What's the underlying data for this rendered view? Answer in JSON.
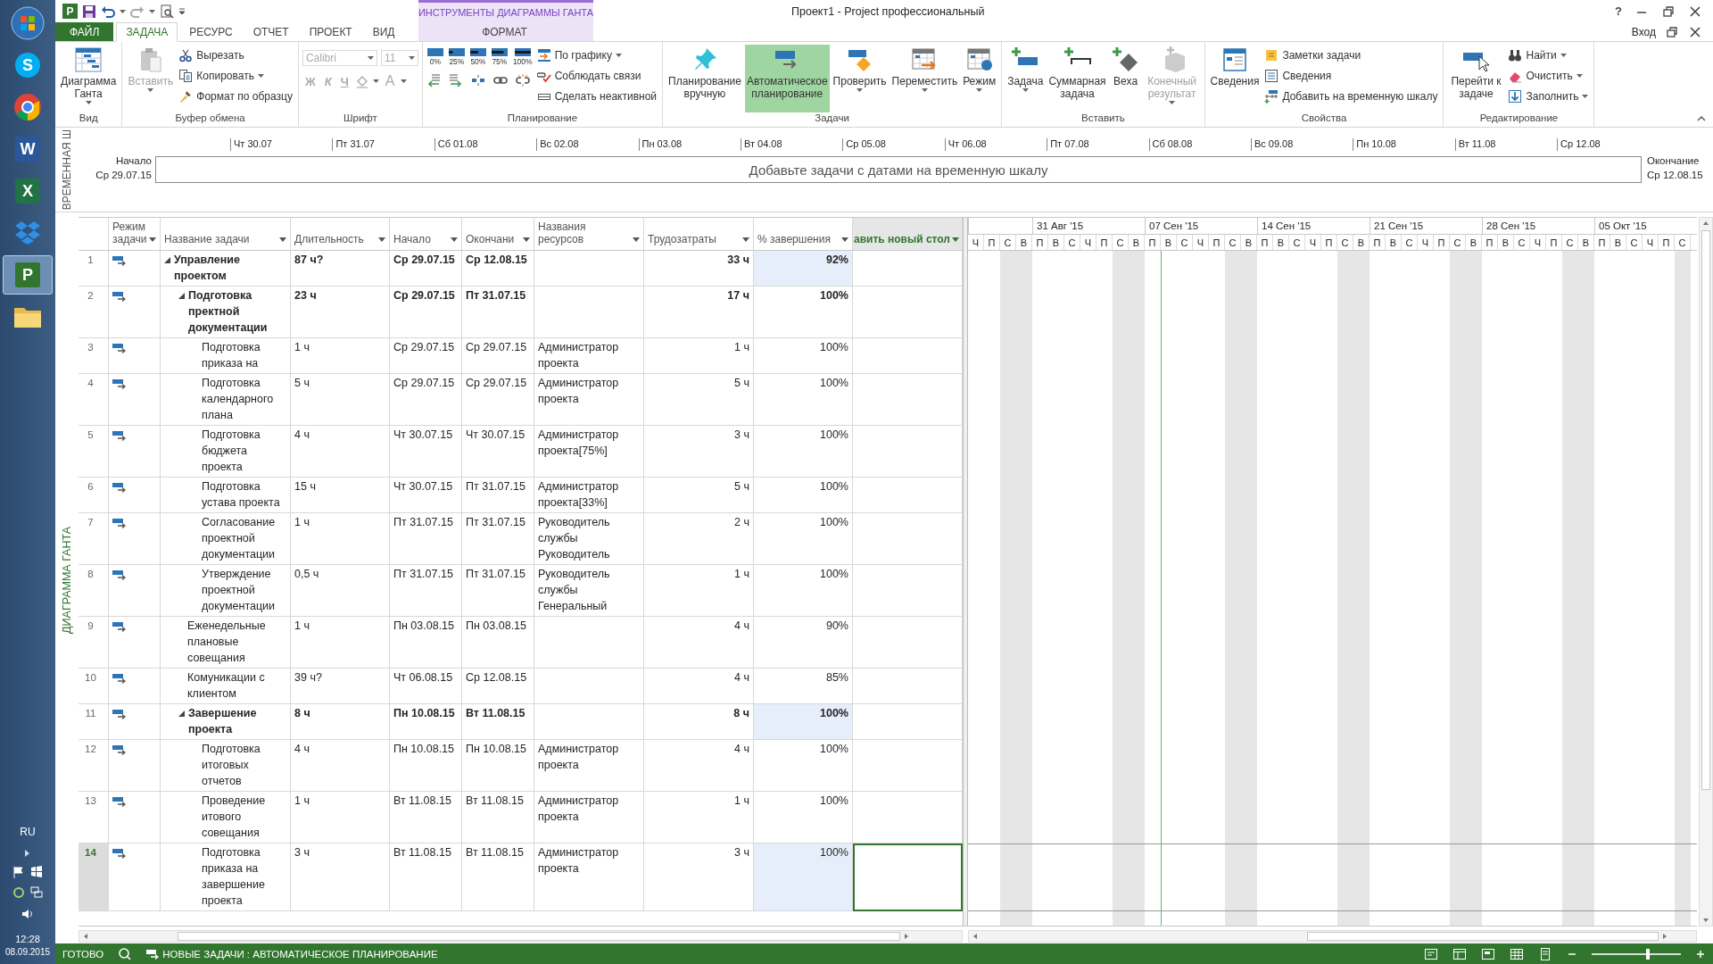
{
  "taskbar": {
    "apps": [
      {
        "kind": "start",
        "selected": false
      },
      {
        "kind": "chat",
        "glyph": "S",
        "selected": false
      },
      {
        "kind": "browser",
        "selected": false
      },
      {
        "kind": "word",
        "glyph": "W",
        "selected": false
      },
      {
        "kind": "sheet",
        "glyph": "X",
        "selected": false
      },
      {
        "kind": "box",
        "selected": false
      },
      {
        "kind": "project",
        "glyph": "P",
        "selected": true
      },
      {
        "kind": "folder",
        "selected": false
      }
    ],
    "language": "RU",
    "time": "12:28",
    "date": "08.09.2015"
  },
  "title_bar": {
    "app_glyph": "P",
    "title": "Проект1 - Project профессиональный",
    "help": "?",
    "context_group": "ИНСТРУМЕНТЫ ДИАГРАММЫ ГАНТА",
    "account": "Вход"
  },
  "tabs": [
    {
      "label": "ФАЙЛ",
      "kind": "file",
      "selected": false
    },
    {
      "label": "ЗАДАЧА",
      "kind": "tab",
      "selected": true
    },
    {
      "label": "РЕСУРС",
      "kind": "tab",
      "selected": false
    },
    {
      "label": "ОТЧЕТ",
      "kind": "tab",
      "selected": false
    },
    {
      "label": "ПРОЕКТ",
      "kind": "tab",
      "selected": false
    },
    {
      "label": "ВИД",
      "kind": "tab",
      "selected": false
    },
    {
      "label": "ФОРМАТ",
      "kind": "contextual",
      "selected": false
    }
  ],
  "ribbon": {
    "groups": [
      {
        "label": "Вид",
        "items": [
          {
            "kind": "large",
            "label": "Диаграмма Ганта",
            "dropdown": true,
            "disabled": false
          }
        ]
      },
      {
        "label": "Буфер обмена",
        "items": [
          {
            "kind": "large",
            "label": "Вставить",
            "dropdown": true,
            "disabled": true
          },
          {
            "kind": "stack",
            "items": [
              {
                "label": "Вырезать",
                "dropdown": false
              },
              {
                "label": "Копировать",
                "dropdown": true
              },
              {
                "label": "Формат по образцу",
                "dropdown": false
              }
            ]
          }
        ]
      },
      {
        "label": "Шрифт",
        "items": [
          {
            "kind": "font",
            "font": "Calibri",
            "size": "11",
            "styles": [
              "Ж",
              "К",
              "Ч"
            ],
            "color_letter": "A",
            "disabled": true
          }
        ]
      },
      {
        "label": "Планирование",
        "items": [
          {
            "kind": "percent",
            "labels": [
              "0%",
              "25%",
              "50%",
              "75%",
              "100%"
            ]
          },
          {
            "kind": "stack",
            "items": [
              {
                "label": "По графику",
                "dropdown": true
              },
              {
                "label": "Соблюдать связи",
                "dropdown": false
              },
              {
                "label": "Сделать неактивной",
                "dropdown": false
              }
            ]
          }
        ]
      },
      {
        "label": "Задачи",
        "items": [
          {
            "kind": "large",
            "label": "Планирование вручную",
            "dropdown": false,
            "disabled": false,
            "selected": false
          },
          {
            "kind": "large",
            "label": "Автоматическое планирование",
            "dropdown": false,
            "disabled": false,
            "selected": true
          },
          {
            "kind": "large",
            "label": "Проверить",
            "dropdown": true,
            "disabled": false
          },
          {
            "kind": "large",
            "label": "Переместить",
            "dropdown": true,
            "disabled": false
          },
          {
            "kind": "large",
            "label": "Режим",
            "dropdown": true,
            "disabled": false
          }
        ]
      },
      {
        "label": "Вставить",
        "items": [
          {
            "kind": "large",
            "label": "Задача",
            "dropdown": true,
            "disabled": false
          },
          {
            "kind": "large",
            "label": "Суммарная задача",
            "dropdown": false,
            "disabled": false
          },
          {
            "kind": "large",
            "label": "Веха",
            "dropdown": false,
            "disabled": false
          },
          {
            "kind": "large",
            "label": "Конечный результат",
            "dropdown": true,
            "disabled": true
          }
        ]
      },
      {
        "label": "Свойства",
        "items": [
          {
            "kind": "large",
            "label": "Сведения",
            "dropdown": false,
            "disabled": false
          },
          {
            "kind": "stack",
            "items": [
              {
                "label": "Заметки задачи",
                "dropdown": false
              },
              {
                "label": "Сведения",
                "dropdown": false
              },
              {
                "label": "Добавить на временную шкалу",
                "dropdown": false
              }
            ]
          }
        ]
      },
      {
        "label": "Редактирование",
        "items": [
          {
            "kind": "large",
            "label": "Перейти к задаче",
            "dropdown": false,
            "disabled": false
          },
          {
            "kind": "stack",
            "items": [
              {
                "label": "Найти",
                "dropdown": true
              },
              {
                "label": "Очистить",
                "dropdown": true
              },
              {
                "label": "Заполнить",
                "dropdown": true
              }
            ]
          }
        ]
      }
    ]
  },
  "timeline": {
    "side_label": "ВРЕМЕННАЯ Ш",
    "start_label": "Начало",
    "start": "Ср 29.07.15",
    "end_label": "Окончание",
    "end": "Ср 12.08.15",
    "hint": "Добавьте задачи с датами на временную шкалу",
    "ticks": [
      "Чт 30.07",
      "Пт 31.07",
      "Сб 01.08",
      "Вс 02.08",
      "Пн 03.08",
      "Вт 04.08",
      "Ср 05.08",
      "Чт 06.08",
      "Пт 07.08",
      "Сб 08.08",
      "Вс 09.08",
      "Пн 10.08",
      "Вт 11.08",
      "Ср 12.08"
    ]
  },
  "view_label": "ДИАГРАММА ГАНТА",
  "table": {
    "columns": [
      {
        "label": "Режим задачи",
        "kind": "text"
      },
      {
        "label": "Название задачи",
        "kind": "text"
      },
      {
        "label": "Длительность",
        "kind": "text"
      },
      {
        "label": "Начало",
        "kind": "text"
      },
      {
        "label": "Окончани",
        "kind": "text"
      },
      {
        "label": "Названия ресурсов",
        "kind": "text"
      },
      {
        "label": "Трудозатраты",
        "kind": "number"
      },
      {
        "label": "% завершения",
        "kind": "number"
      },
      {
        "label": "авить новый стол",
        "kind": "add"
      }
    ],
    "tasks": [
      {
        "id": "1",
        "name": "Управление проектом",
        "duration": "87 ч?",
        "start": "Ср 29.07.15",
        "finish": "Ср 12.08.15",
        "work": "33 ч",
        "complete": "92%",
        "highlighted": true,
        "selected": false,
        "expanded": true,
        "children": [
          {
            "id": "2",
            "name": "Подготовка пректной документации",
            "duration": "23 ч",
            "start": "Ср 29.07.15",
            "finish": "Пт 31.07.15",
            "work": "17 ч",
            "complete": "100%",
            "highlighted": false,
            "selected": false,
            "expanded": true,
            "children": [
              {
                "id": "3",
                "name": "Подготовка приказа на",
                "duration": "1 ч",
                "start": "Ср 29.07.15",
                "finish": "Ср 29.07.15",
                "resources": "Администратор проекта",
                "work": "1 ч",
                "complete": "100%",
                "highlighted": false,
                "selected": false
              },
              {
                "id": "4",
                "name": "Подготовка календарного плана",
                "duration": "5 ч",
                "start": "Ср 29.07.15",
                "finish": "Ср 29.07.15",
                "resources": "Администратор проекта",
                "work": "5 ч",
                "complete": "100%",
                "highlighted": false,
                "selected": false
              },
              {
                "id": "5",
                "name": "Подготовка бюджета проекта",
                "duration": "4 ч",
                "start": "Чт 30.07.15",
                "finish": "Чт 30.07.15",
                "resources": "Администратор проекта[75%]",
                "work": "3 ч",
                "complete": "100%",
                "highlighted": false,
                "selected": false
              },
              {
                "id": "6",
                "name": "Подготовка устава проекта",
                "duration": "15 ч",
                "start": "Чт 30.07.15",
                "finish": "Пт 31.07.15",
                "resources": "Администратор проекта[33%]",
                "work": "5 ч",
                "complete": "100%",
                "highlighted": false,
                "selected": false
              },
              {
                "id": "7",
                "name": "Согласование проектной документации",
                "duration": "1 ч",
                "start": "Пт 31.07.15",
                "finish": "Пт 31.07.15",
                "resources": "Руководитель службы Руководитель",
                "work": "2 ч",
                "complete": "100%",
                "highlighted": false,
                "selected": false
              },
              {
                "id": "8",
                "name": "Утверждение проектной документации",
                "duration": "0,5 ч",
                "start": "Пт 31.07.15",
                "finish": "Пт 31.07.15",
                "resources": "Руководитель службы Генеральный",
                "work": "1 ч",
                "complete": "100%",
                "highlighted": false,
                "selected": false
              }
            ]
          },
          {
            "id": "9",
            "name": "Еженедельные плановые совещания",
            "duration": "1 ч",
            "start": "Пн 03.08.15",
            "finish": "Пн 03.08.15",
            "work": "4 ч",
            "complete": "90%",
            "highlighted": false,
            "selected": false
          },
          {
            "id": "10",
            "name": "Комуникации с клиентом",
            "duration": "39 ч?",
            "start": "Чт 06.08.15",
            "finish": "Ср 12.08.15",
            "work": "4 ч",
            "complete": "85%",
            "highlighted": false,
            "selected": false
          },
          {
            "id": "11",
            "name": "Завершение проекта",
            "duration": "8 ч",
            "start": "Пн 10.08.15",
            "finish": "Вт 11.08.15",
            "work": "8 ч",
            "complete": "100%",
            "highlighted": true,
            "selected": false,
            "expanded": true,
            "children": [
              {
                "id": "12",
                "name": "Подготовка итоговых отчетов",
                "duration": "4 ч",
                "start": "Пн 10.08.15",
                "finish": "Пн 10.08.15",
                "resources": "Администратор проекта",
                "work": "4 ч",
                "complete": "100%",
                "highlighted": false,
                "selected": false
              },
              {
                "id": "13",
                "name": "Проведение итового совещания",
                "duration": "1 ч",
                "start": "Вт 11.08.15",
                "finish": "Вт 11.08.15",
                "resources": "Администратор проекта",
                "work": "1 ч",
                "complete": "100%",
                "highlighted": false,
                "selected": false
              },
              {
                "id": "14",
                "name": "Подготовка приказа на завершение проекта",
                "duration": "3 ч",
                "start": "Вт 11.08.15",
                "finish": "Вт 11.08.15",
                "resources": "Администратор проекта",
                "work": "3 ч",
                "complete": "100%",
                "highlighted": true,
                "selected": true
              }
            ]
          }
        ]
      }
    ]
  },
  "gantt": {
    "lead_days": [
      {
        "label": "Ч",
        "nonworking": false,
        "today": false
      },
      {
        "label": "П",
        "nonworking": false,
        "today": false
      },
      {
        "label": "С",
        "nonworking": true,
        "today": false
      },
      {
        "label": "В",
        "nonworking": true,
        "today": false
      }
    ],
    "weeks": [
      {
        "label": "31 Авг '15",
        "days": [
          {
            "label": "П",
            "nonworking": false,
            "today": false
          },
          {
            "label": "В",
            "nonworking": false,
            "today": false
          },
          {
            "label": "С",
            "nonworking": false,
            "today": false
          },
          {
            "label": "Ч",
            "nonworking": false,
            "today": false
          },
          {
            "label": "П",
            "nonworking": false,
            "today": false
          },
          {
            "label": "С",
            "nonworking": true,
            "today": false
          },
          {
            "label": "В",
            "nonworking": true,
            "today": false
          }
        ]
      },
      {
        "label": "07 Сен '15",
        "days": [
          {
            "label": "П",
            "nonworking": false,
            "today": false
          },
          {
            "label": "В",
            "nonworking": false,
            "today": true
          },
          {
            "label": "С",
            "nonworking": false,
            "today": false
          },
          {
            "label": "Ч",
            "nonworking": false,
            "today": false
          },
          {
            "label": "П",
            "nonworking": false,
            "today": false
          },
          {
            "label": "С",
            "nonworking": true,
            "today": false
          },
          {
            "label": "В",
            "nonworking": true,
            "today": false
          }
        ]
      },
      {
        "label": "14 Сен '15",
        "days": [
          {
            "label": "П",
            "nonworking": false,
            "today": false
          },
          {
            "label": "В",
            "nonworking": false,
            "today": false
          },
          {
            "label": "С",
            "nonworking": false,
            "today": false
          },
          {
            "label": "Ч",
            "nonworking": false,
            "today": false
          },
          {
            "label": "П",
            "nonworking": false,
            "today": false
          },
          {
            "label": "С",
            "nonworking": true,
            "today": false
          },
          {
            "label": "В",
            "nonworking": true,
            "today": false
          }
        ]
      },
      {
        "label": "21 Сен '15",
        "days": [
          {
            "label": "П",
            "nonworking": false,
            "today": false
          },
          {
            "label": "В",
            "nonworking": false,
            "today": false
          },
          {
            "label": "С",
            "nonworking": false,
            "today": false
          },
          {
            "label": "Ч",
            "nonworking": false,
            "today": false
          },
          {
            "label": "П",
            "nonworking": false,
            "today": false
          },
          {
            "label": "С",
            "nonworking": true,
            "today": false
          },
          {
            "label": "В",
            "nonworking": true,
            "today": false
          }
        ]
      },
      {
        "label": "28 Сен '15",
        "days": [
          {
            "label": "П",
            "nonworking": false,
            "today": false
          },
          {
            "label": "В",
            "nonworking": false,
            "today": false
          },
          {
            "label": "С",
            "nonworking": false,
            "today": false
          },
          {
            "label": "Ч",
            "nonworking": false,
            "today": false
          },
          {
            "label": "П",
            "nonworking": false,
            "today": false
          },
          {
            "label": "С",
            "nonworking": true,
            "today": false
          },
          {
            "label": "В",
            "nonworking": true,
            "today": false
          }
        ]
      },
      {
        "label": "05 Окт '15",
        "days": [
          {
            "label": "П",
            "nonworking": false,
            "today": false
          },
          {
            "label": "В",
            "nonworking": false,
            "today": false
          },
          {
            "label": "С",
            "nonworking": false,
            "today": false
          },
          {
            "label": "Ч",
            "nonworking": false,
            "today": false
          },
          {
            "label": "П",
            "nonworking": false,
            "today": false
          },
          {
            "label": "С",
            "nonworking": true,
            "today": false
          }
        ]
      }
    ]
  },
  "status_bar": {
    "ready": "ГОТОВО",
    "new_tasks": "НОВЫЕ ЗАДАЧИ : АВТОМАТИЧЕСКОЕ ПЛАНИРОВАНИЕ",
    "zoom": {
      "level": 0.63
    }
  }
}
